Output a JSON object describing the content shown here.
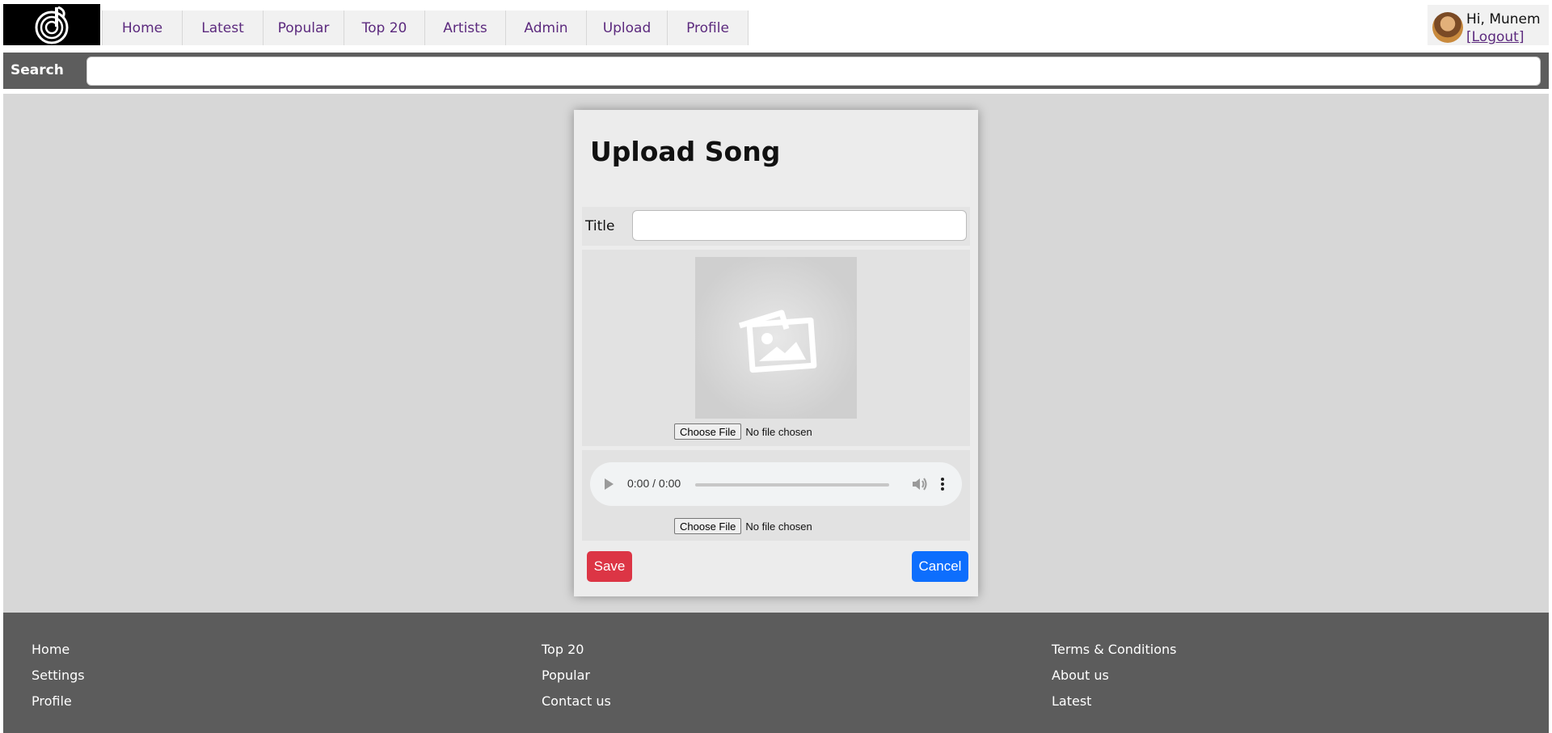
{
  "header": {
    "logo_icon": "music-note-disc-logo",
    "nav": [
      {
        "label": "Home"
      },
      {
        "label": "Latest"
      },
      {
        "label": "Popular"
      },
      {
        "label": "Top 20"
      },
      {
        "label": "Artists"
      },
      {
        "label": "Admin"
      },
      {
        "label": "Upload"
      },
      {
        "label": "Profile"
      }
    ],
    "user": {
      "greeting": "Hi, Munem",
      "logout_label": "[Logout]"
    }
  },
  "search": {
    "label": "Search",
    "value": ""
  },
  "form": {
    "title": "Upload Song",
    "title_field": {
      "label": "Title",
      "value": ""
    },
    "image_upload": {
      "placeholder_icon": "image-placeholder-icon",
      "button_label": "Choose File",
      "status": "No file chosen"
    },
    "audio_player": {
      "time": "0:00 / 0:00"
    },
    "audio_upload": {
      "button_label": "Choose File",
      "status": "No file chosen"
    },
    "save_label": "Save",
    "cancel_label": "Cancel"
  },
  "footer": {
    "columns": [
      [
        "Home",
        "Settings",
        "Profile"
      ],
      [
        "Top 20",
        "Popular",
        "Contact us"
      ],
      [
        "Terms & Conditions",
        "About us",
        "Latest"
      ]
    ]
  },
  "colors": {
    "nav_text": "#5c2a7e",
    "save": "#dc3545",
    "cancel": "#0d6efd",
    "footer_bg": "#5c5c5c",
    "searchbar_bg": "#5d5d5d"
  }
}
